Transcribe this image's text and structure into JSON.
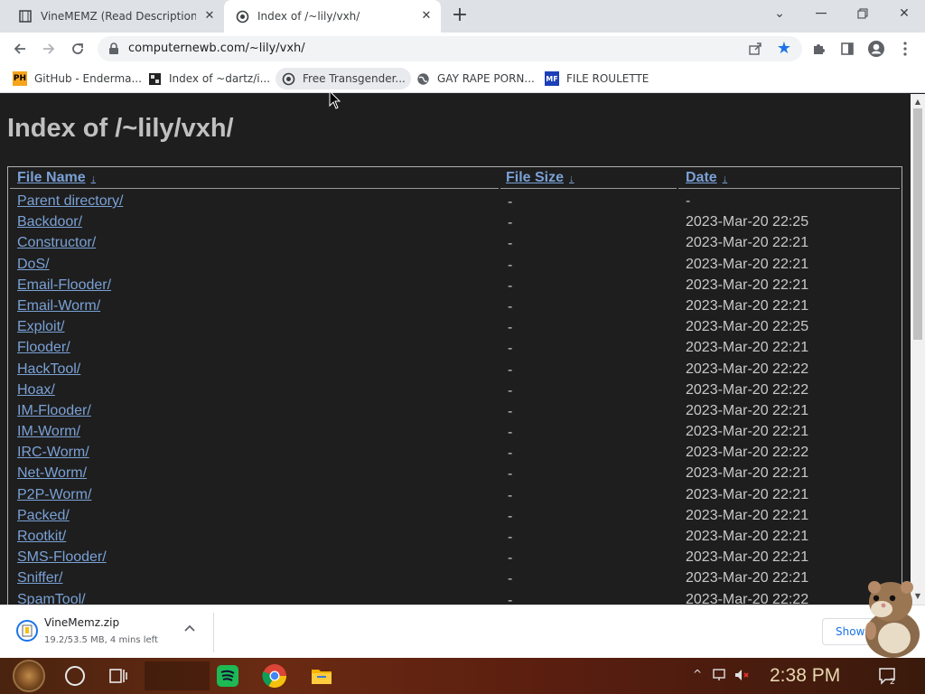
{
  "browser": {
    "tabs": [
      {
        "title": "VineMEMZ (Read Description)",
        "active": false,
        "favicon": "film-strip-icon"
      },
      {
        "title": "Index of /~lily/vxh/",
        "active": true,
        "favicon": "camera-lens-icon"
      }
    ],
    "url": "computernewb.com/~lily/vxh/",
    "bookmarked": true,
    "bookmarks": [
      {
        "label": "GitHub - Enderma...",
        "favicon": "PH"
      },
      {
        "label": "Index of ~dartz/i...",
        "favicon": "grid-icon"
      },
      {
        "label": "Free Transgender...",
        "favicon": "camera-lens-icon"
      },
      {
        "label": "GAY RAPE PORN...",
        "favicon": "globe-icon"
      },
      {
        "label": "FILE ROULETTE",
        "favicon": "MF"
      }
    ]
  },
  "page": {
    "title": "Index of /~lily/vxh/",
    "columns": {
      "name": "File Name",
      "size": "File Size",
      "date": "Date",
      "sort_arrow": "↓"
    },
    "rows": [
      {
        "name": "Parent directory/",
        "size": "-",
        "date": "-"
      },
      {
        "name": "Backdoor/",
        "size": "-",
        "date": "2023-Mar-20 22:25"
      },
      {
        "name": "Constructor/",
        "size": "-",
        "date": "2023-Mar-20 22:21"
      },
      {
        "name": "DoS/",
        "size": "-",
        "date": "2023-Mar-20 22:21"
      },
      {
        "name": "Email-Flooder/",
        "size": "-",
        "date": "2023-Mar-20 22:21"
      },
      {
        "name": "Email-Worm/",
        "size": "-",
        "date": "2023-Mar-20 22:21"
      },
      {
        "name": "Exploit/",
        "size": "-",
        "date": "2023-Mar-20 22:25"
      },
      {
        "name": "Flooder/",
        "size": "-",
        "date": "2023-Mar-20 22:21"
      },
      {
        "name": "HackTool/",
        "size": "-",
        "date": "2023-Mar-20 22:22"
      },
      {
        "name": "Hoax/",
        "size": "-",
        "date": "2023-Mar-20 22:22"
      },
      {
        "name": "IM-Flooder/",
        "size": "-",
        "date": "2023-Mar-20 22:21"
      },
      {
        "name": "IM-Worm/",
        "size": "-",
        "date": "2023-Mar-20 22:21"
      },
      {
        "name": "IRC-Worm/",
        "size": "-",
        "date": "2023-Mar-20 22:22"
      },
      {
        "name": "Net-Worm/",
        "size": "-",
        "date": "2023-Mar-20 22:21"
      },
      {
        "name": "P2P-Worm/",
        "size": "-",
        "date": "2023-Mar-20 22:21"
      },
      {
        "name": "Packed/",
        "size": "-",
        "date": "2023-Mar-20 22:21"
      },
      {
        "name": "Rootkit/",
        "size": "-",
        "date": "2023-Mar-20 22:21"
      },
      {
        "name": "SMS-Flooder/",
        "size": "-",
        "date": "2023-Mar-20 22:21"
      },
      {
        "name": "Sniffer/",
        "size": "-",
        "date": "2023-Mar-20 22:21"
      },
      {
        "name": "SpamTool/",
        "size": "-",
        "date": "2023-Mar-20 22:22"
      }
    ]
  },
  "download": {
    "filename": "VineMemz.zip",
    "status": "19.2/53.5 MB, 4 mins left",
    "show_all": "Show"
  },
  "taskbar": {
    "time": "2:38 PM",
    "notification_count": "2"
  },
  "colors": {
    "page_bg": "#1e1e1e",
    "link": "#7aa1d6",
    "text": "#c8c8c8",
    "accent": "#1a73e8"
  }
}
